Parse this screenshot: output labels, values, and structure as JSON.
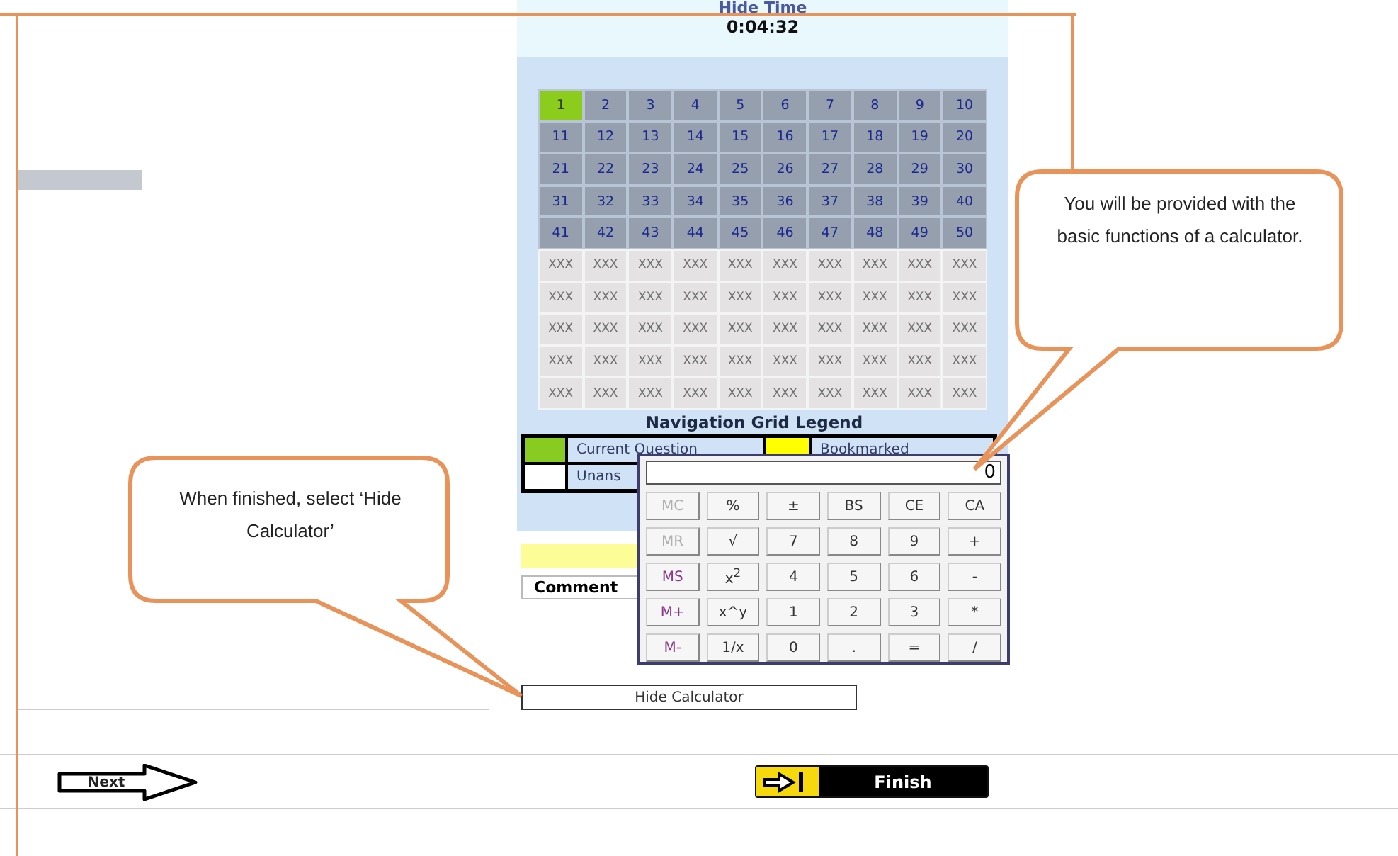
{
  "timer": {
    "label": "Hide Time",
    "value": "0:04:32"
  },
  "grid": {
    "cells": [
      {
        "label": "1",
        "selected": true,
        "disabled": false
      },
      {
        "label": "2",
        "selected": false,
        "disabled": false
      },
      {
        "label": "3",
        "selected": false,
        "disabled": false
      },
      {
        "label": "4",
        "selected": false,
        "disabled": false
      },
      {
        "label": "5",
        "selected": false,
        "disabled": false
      },
      {
        "label": "6",
        "selected": false,
        "disabled": false
      },
      {
        "label": "7",
        "selected": false,
        "disabled": false
      },
      {
        "label": "8",
        "selected": false,
        "disabled": false
      },
      {
        "label": "9",
        "selected": false,
        "disabled": false
      },
      {
        "label": "10",
        "selected": false,
        "disabled": false
      },
      {
        "label": "11",
        "selected": false,
        "disabled": false
      },
      {
        "label": "12",
        "selected": false,
        "disabled": false
      },
      {
        "label": "13",
        "selected": false,
        "disabled": false
      },
      {
        "label": "14",
        "selected": false,
        "disabled": false
      },
      {
        "label": "15",
        "selected": false,
        "disabled": false
      },
      {
        "label": "16",
        "selected": false,
        "disabled": false
      },
      {
        "label": "17",
        "selected": false,
        "disabled": false
      },
      {
        "label": "18",
        "selected": false,
        "disabled": false
      },
      {
        "label": "19",
        "selected": false,
        "disabled": false
      },
      {
        "label": "20",
        "selected": false,
        "disabled": false
      },
      {
        "label": "21",
        "selected": false,
        "disabled": false
      },
      {
        "label": "22",
        "selected": false,
        "disabled": false
      },
      {
        "label": "23",
        "selected": false,
        "disabled": false
      },
      {
        "label": "24",
        "selected": false,
        "disabled": false
      },
      {
        "label": "25",
        "selected": false,
        "disabled": false
      },
      {
        "label": "26",
        "selected": false,
        "disabled": false
      },
      {
        "label": "27",
        "selected": false,
        "disabled": false
      },
      {
        "label": "28",
        "selected": false,
        "disabled": false
      },
      {
        "label": "29",
        "selected": false,
        "disabled": false
      },
      {
        "label": "30",
        "selected": false,
        "disabled": false
      },
      {
        "label": "31",
        "selected": false,
        "disabled": false
      },
      {
        "label": "32",
        "selected": false,
        "disabled": false
      },
      {
        "label": "33",
        "selected": false,
        "disabled": false
      },
      {
        "label": "34",
        "selected": false,
        "disabled": false
      },
      {
        "label": "35",
        "selected": false,
        "disabled": false
      },
      {
        "label": "36",
        "selected": false,
        "disabled": false
      },
      {
        "label": "37",
        "selected": false,
        "disabled": false
      },
      {
        "label": "38",
        "selected": false,
        "disabled": false
      },
      {
        "label": "39",
        "selected": false,
        "disabled": false
      },
      {
        "label": "40",
        "selected": false,
        "disabled": false
      },
      {
        "label": "41",
        "selected": false,
        "disabled": false
      },
      {
        "label": "42",
        "selected": false,
        "disabled": false
      },
      {
        "label": "43",
        "selected": false,
        "disabled": false
      },
      {
        "label": "44",
        "selected": false,
        "disabled": false
      },
      {
        "label": "45",
        "selected": false,
        "disabled": false
      },
      {
        "label": "46",
        "selected": false,
        "disabled": false
      },
      {
        "label": "47",
        "selected": false,
        "disabled": false
      },
      {
        "label": "48",
        "selected": false,
        "disabled": false
      },
      {
        "label": "49",
        "selected": false,
        "disabled": false
      },
      {
        "label": "50",
        "selected": false,
        "disabled": false
      },
      {
        "label": "XXX",
        "selected": false,
        "disabled": true
      },
      {
        "label": "XXX",
        "selected": false,
        "disabled": true
      },
      {
        "label": "XXX",
        "selected": false,
        "disabled": true
      },
      {
        "label": "XXX",
        "selected": false,
        "disabled": true
      },
      {
        "label": "XXX",
        "selected": false,
        "disabled": true
      },
      {
        "label": "XXX",
        "selected": false,
        "disabled": true
      },
      {
        "label": "XXX",
        "selected": false,
        "disabled": true
      },
      {
        "label": "XXX",
        "selected": false,
        "disabled": true
      },
      {
        "label": "XXX",
        "selected": false,
        "disabled": true
      },
      {
        "label": "XXX",
        "selected": false,
        "disabled": true
      },
      {
        "label": "XXX",
        "selected": false,
        "disabled": true
      },
      {
        "label": "XXX",
        "selected": false,
        "disabled": true
      },
      {
        "label": "XXX",
        "selected": false,
        "disabled": true
      },
      {
        "label": "XXX",
        "selected": false,
        "disabled": true
      },
      {
        "label": "XXX",
        "selected": false,
        "disabled": true
      },
      {
        "label": "XXX",
        "selected": false,
        "disabled": true
      },
      {
        "label": "XXX",
        "selected": false,
        "disabled": true
      },
      {
        "label": "XXX",
        "selected": false,
        "disabled": true
      },
      {
        "label": "XXX",
        "selected": false,
        "disabled": true
      },
      {
        "label": "XXX",
        "selected": false,
        "disabled": true
      },
      {
        "label": "XXX",
        "selected": false,
        "disabled": true
      },
      {
        "label": "XXX",
        "selected": false,
        "disabled": true
      },
      {
        "label": "XXX",
        "selected": false,
        "disabled": true
      },
      {
        "label": "XXX",
        "selected": false,
        "disabled": true
      },
      {
        "label": "XXX",
        "selected": false,
        "disabled": true
      },
      {
        "label": "XXX",
        "selected": false,
        "disabled": true
      },
      {
        "label": "XXX",
        "selected": false,
        "disabled": true
      },
      {
        "label": "XXX",
        "selected": false,
        "disabled": true
      },
      {
        "label": "XXX",
        "selected": false,
        "disabled": true
      },
      {
        "label": "XXX",
        "selected": false,
        "disabled": true
      },
      {
        "label": "XXX",
        "selected": false,
        "disabled": true
      },
      {
        "label": "XXX",
        "selected": false,
        "disabled": true
      },
      {
        "label": "XXX",
        "selected": false,
        "disabled": true
      },
      {
        "label": "XXX",
        "selected": false,
        "disabled": true
      },
      {
        "label": "XXX",
        "selected": false,
        "disabled": true
      },
      {
        "label": "XXX",
        "selected": false,
        "disabled": true
      },
      {
        "label": "XXX",
        "selected": false,
        "disabled": true
      },
      {
        "label": "XXX",
        "selected": false,
        "disabled": true
      },
      {
        "label": "XXX",
        "selected": false,
        "disabled": true
      },
      {
        "label": "XXX",
        "selected": false,
        "disabled": true
      },
      {
        "label": "XXX",
        "selected": false,
        "disabled": true
      },
      {
        "label": "XXX",
        "selected": false,
        "disabled": true
      },
      {
        "label": "XXX",
        "selected": false,
        "disabled": true
      },
      {
        "label": "XXX",
        "selected": false,
        "disabled": true
      },
      {
        "label": "XXX",
        "selected": false,
        "disabled": true
      },
      {
        "label": "XXX",
        "selected": false,
        "disabled": true
      },
      {
        "label": "XXX",
        "selected": false,
        "disabled": true
      },
      {
        "label": "XXX",
        "selected": false,
        "disabled": true
      },
      {
        "label": "XXX",
        "selected": false,
        "disabled": true
      },
      {
        "label": "XXX",
        "selected": false,
        "disabled": true
      }
    ]
  },
  "legend": {
    "title": "Navigation Grid Legend",
    "items": [
      {
        "label": "Current Question",
        "color": "#88cc22"
      },
      {
        "label": "Bookmarked",
        "color": "#ffff00"
      },
      {
        "label": "Unans",
        "color": "#ffffff"
      }
    ]
  },
  "comment_button": "Comment",
  "hide_calculator_button": "Hide Calculator",
  "calculator": {
    "display": "0",
    "keys": [
      {
        "label": "MC",
        "kind": "memory",
        "disabled": true
      },
      {
        "label": "%",
        "kind": "function",
        "disabled": false
      },
      {
        "label": "±",
        "kind": "function",
        "disabled": false
      },
      {
        "label": "BS",
        "kind": "function",
        "disabled": false
      },
      {
        "label": "CE",
        "kind": "function",
        "disabled": false
      },
      {
        "label": "CA",
        "kind": "function",
        "disabled": false
      },
      {
        "label": "MR",
        "kind": "memory",
        "disabled": true
      },
      {
        "label": "√",
        "kind": "function",
        "disabled": false
      },
      {
        "label": "7",
        "kind": "digit",
        "disabled": false
      },
      {
        "label": "8",
        "kind": "digit",
        "disabled": false
      },
      {
        "label": "9",
        "kind": "digit",
        "disabled": false
      },
      {
        "label": "+",
        "kind": "function",
        "disabled": false
      },
      {
        "label": "MS",
        "kind": "memory",
        "disabled": false
      },
      {
        "label": "x$^{2}$",
        "kind": "function",
        "disabled": false
      },
      {
        "label": "4",
        "kind": "digit",
        "disabled": false
      },
      {
        "label": "5",
        "kind": "digit",
        "disabled": false
      },
      {
        "label": "6",
        "kind": "digit",
        "disabled": false
      },
      {
        "label": "-",
        "kind": "function",
        "disabled": false
      },
      {
        "label": "M+",
        "kind": "memory",
        "disabled": false
      },
      {
        "label": "x^y",
        "kind": "function",
        "disabled": false
      },
      {
        "label": "1",
        "kind": "digit",
        "disabled": false
      },
      {
        "label": "2",
        "kind": "digit",
        "disabled": false
      },
      {
        "label": "3",
        "kind": "digit",
        "disabled": false
      },
      {
        "label": "*",
        "kind": "function",
        "disabled": false
      },
      {
        "label": "M-",
        "kind": "memory",
        "disabled": false
      },
      {
        "label": "1/x",
        "kind": "function",
        "disabled": false
      },
      {
        "label": "0",
        "kind": "digit",
        "disabled": false
      },
      {
        "label": ".",
        "kind": "function",
        "disabled": false
      },
      {
        "label": "=",
        "kind": "function",
        "disabled": false
      },
      {
        "label": "/",
        "kind": "function",
        "disabled": false
      }
    ]
  },
  "navigation": {
    "next": "Next",
    "finish": "Finish"
  },
  "callouts": [
    {
      "text": "You will be provided with the basic functions of a calculator."
    },
    {
      "text": "When finished, select ‘Hide Calculator’"
    }
  ]
}
